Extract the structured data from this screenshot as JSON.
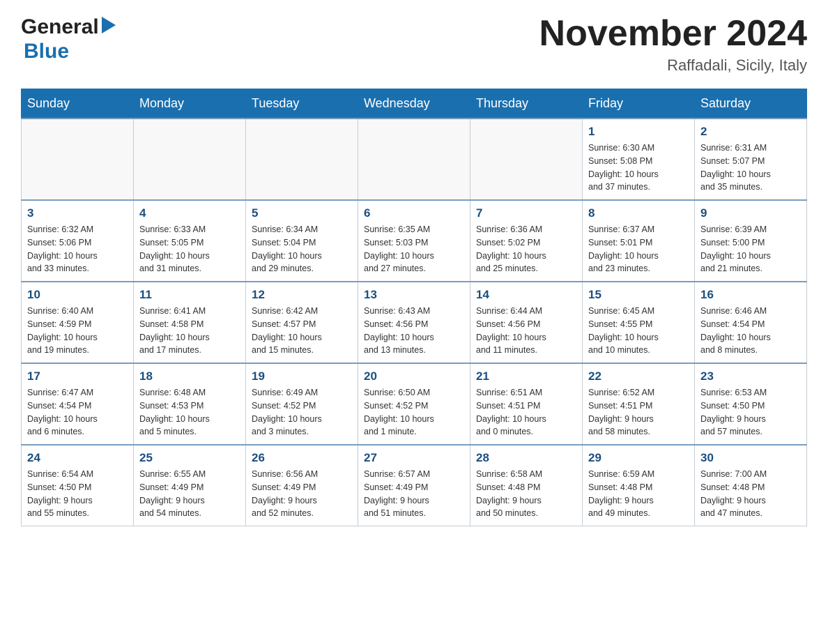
{
  "header": {
    "logo_general": "General",
    "logo_blue": "Blue",
    "month_title": "November 2024",
    "location": "Raffadali, Sicily, Italy"
  },
  "weekdays": [
    "Sunday",
    "Monday",
    "Tuesday",
    "Wednesday",
    "Thursday",
    "Friday",
    "Saturday"
  ],
  "rows": [
    [
      {
        "day": "",
        "info": ""
      },
      {
        "day": "",
        "info": ""
      },
      {
        "day": "",
        "info": ""
      },
      {
        "day": "",
        "info": ""
      },
      {
        "day": "",
        "info": ""
      },
      {
        "day": "1",
        "info": "Sunrise: 6:30 AM\nSunset: 5:08 PM\nDaylight: 10 hours\nand 37 minutes."
      },
      {
        "day": "2",
        "info": "Sunrise: 6:31 AM\nSunset: 5:07 PM\nDaylight: 10 hours\nand 35 minutes."
      }
    ],
    [
      {
        "day": "3",
        "info": "Sunrise: 6:32 AM\nSunset: 5:06 PM\nDaylight: 10 hours\nand 33 minutes."
      },
      {
        "day": "4",
        "info": "Sunrise: 6:33 AM\nSunset: 5:05 PM\nDaylight: 10 hours\nand 31 minutes."
      },
      {
        "day": "5",
        "info": "Sunrise: 6:34 AM\nSunset: 5:04 PM\nDaylight: 10 hours\nand 29 minutes."
      },
      {
        "day": "6",
        "info": "Sunrise: 6:35 AM\nSunset: 5:03 PM\nDaylight: 10 hours\nand 27 minutes."
      },
      {
        "day": "7",
        "info": "Sunrise: 6:36 AM\nSunset: 5:02 PM\nDaylight: 10 hours\nand 25 minutes."
      },
      {
        "day": "8",
        "info": "Sunrise: 6:37 AM\nSunset: 5:01 PM\nDaylight: 10 hours\nand 23 minutes."
      },
      {
        "day": "9",
        "info": "Sunrise: 6:39 AM\nSunset: 5:00 PM\nDaylight: 10 hours\nand 21 minutes."
      }
    ],
    [
      {
        "day": "10",
        "info": "Sunrise: 6:40 AM\nSunset: 4:59 PM\nDaylight: 10 hours\nand 19 minutes."
      },
      {
        "day": "11",
        "info": "Sunrise: 6:41 AM\nSunset: 4:58 PM\nDaylight: 10 hours\nand 17 minutes."
      },
      {
        "day": "12",
        "info": "Sunrise: 6:42 AM\nSunset: 4:57 PM\nDaylight: 10 hours\nand 15 minutes."
      },
      {
        "day": "13",
        "info": "Sunrise: 6:43 AM\nSunset: 4:56 PM\nDaylight: 10 hours\nand 13 minutes."
      },
      {
        "day": "14",
        "info": "Sunrise: 6:44 AM\nSunset: 4:56 PM\nDaylight: 10 hours\nand 11 minutes."
      },
      {
        "day": "15",
        "info": "Sunrise: 6:45 AM\nSunset: 4:55 PM\nDaylight: 10 hours\nand 10 minutes."
      },
      {
        "day": "16",
        "info": "Sunrise: 6:46 AM\nSunset: 4:54 PM\nDaylight: 10 hours\nand 8 minutes."
      }
    ],
    [
      {
        "day": "17",
        "info": "Sunrise: 6:47 AM\nSunset: 4:54 PM\nDaylight: 10 hours\nand 6 minutes."
      },
      {
        "day": "18",
        "info": "Sunrise: 6:48 AM\nSunset: 4:53 PM\nDaylight: 10 hours\nand 5 minutes."
      },
      {
        "day": "19",
        "info": "Sunrise: 6:49 AM\nSunset: 4:52 PM\nDaylight: 10 hours\nand 3 minutes."
      },
      {
        "day": "20",
        "info": "Sunrise: 6:50 AM\nSunset: 4:52 PM\nDaylight: 10 hours\nand 1 minute."
      },
      {
        "day": "21",
        "info": "Sunrise: 6:51 AM\nSunset: 4:51 PM\nDaylight: 10 hours\nand 0 minutes."
      },
      {
        "day": "22",
        "info": "Sunrise: 6:52 AM\nSunset: 4:51 PM\nDaylight: 9 hours\nand 58 minutes."
      },
      {
        "day": "23",
        "info": "Sunrise: 6:53 AM\nSunset: 4:50 PM\nDaylight: 9 hours\nand 57 minutes."
      }
    ],
    [
      {
        "day": "24",
        "info": "Sunrise: 6:54 AM\nSunset: 4:50 PM\nDaylight: 9 hours\nand 55 minutes."
      },
      {
        "day": "25",
        "info": "Sunrise: 6:55 AM\nSunset: 4:49 PM\nDaylight: 9 hours\nand 54 minutes."
      },
      {
        "day": "26",
        "info": "Sunrise: 6:56 AM\nSunset: 4:49 PM\nDaylight: 9 hours\nand 52 minutes."
      },
      {
        "day": "27",
        "info": "Sunrise: 6:57 AM\nSunset: 4:49 PM\nDaylight: 9 hours\nand 51 minutes."
      },
      {
        "day": "28",
        "info": "Sunrise: 6:58 AM\nSunset: 4:48 PM\nDaylight: 9 hours\nand 50 minutes."
      },
      {
        "day": "29",
        "info": "Sunrise: 6:59 AM\nSunset: 4:48 PM\nDaylight: 9 hours\nand 49 minutes."
      },
      {
        "day": "30",
        "info": "Sunrise: 7:00 AM\nSunset: 4:48 PM\nDaylight: 9 hours\nand 47 minutes."
      }
    ]
  ]
}
